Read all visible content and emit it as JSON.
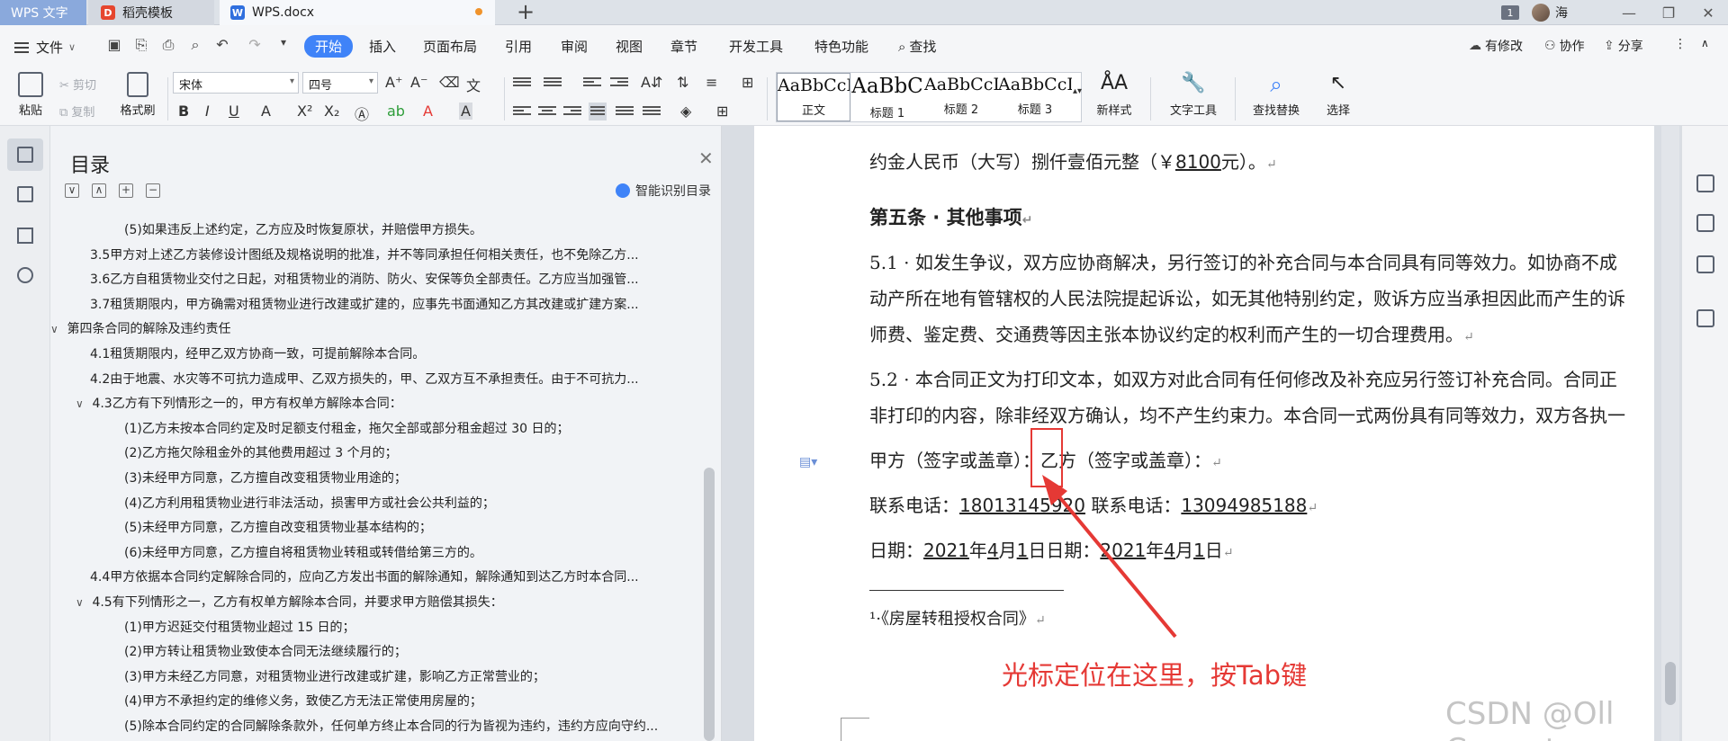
{
  "titlebar": {
    "tabs": [
      {
        "label": "WPS 文字"
      },
      {
        "label": "稻壳模板"
      },
      {
        "label": "WPS.docx"
      }
    ],
    "new_tab": "+",
    "window_count": "1",
    "username": "海",
    "win_min": "—",
    "win_max": "❐",
    "win_close": "✕"
  },
  "menubar": {
    "file": "文件",
    "tabs": [
      "开始",
      "插入",
      "页面布局",
      "引用",
      "审阅",
      "视图",
      "章节",
      "开发工具",
      "特色功能",
      "查找"
    ],
    "active_tab": "开始",
    "right": {
      "changes": "有修改",
      "collab": "协作",
      "share": "分享"
    }
  },
  "ribbon": {
    "paste": "粘贴",
    "cut": "剪切",
    "copy": "复制",
    "format_painter": "格式刷",
    "font_name": "宋体",
    "font_size": "四号",
    "styles": [
      {
        "sample": "AaBbCcDd",
        "name": "正文"
      },
      {
        "sample": "AaBbC",
        "name": "标题 1"
      },
      {
        "sample": "AaBbCcD",
        "name": "标题 2"
      },
      {
        "sample": "AaBbCcD",
        "name": "标题 3"
      }
    ],
    "new_style": "新样式",
    "text_tools": "文字工具",
    "find_replace": "查找替换",
    "select": "选择"
  },
  "toc": {
    "title": "目录",
    "smart": "智能识别目录",
    "items": [
      {
        "text": "(5)如果违反上述约定，乙方应及时恢复原状，并赔偿甲方损失。",
        "level": 3,
        "arrow": ""
      },
      {
        "text": "3.5甲方对上述乙方装修设计图纸及规格说明的批准，并不等同承担任何相关责任，也不免除乙方...",
        "level": 2,
        "arrow": ""
      },
      {
        "text": "3.6乙方自租赁物业交付之日起，对租赁物业的消防、防火、安保等负全部责任。乙方应当加强管...",
        "level": 2,
        "arrow": ""
      },
      {
        "text": "3.7租赁期限内，甲方确需对租赁物业进行改建或扩建的，应事先书面通知乙方其改建或扩建方案...",
        "level": 2,
        "arrow": ""
      },
      {
        "text": "第四条合同的解除及违约责任",
        "level": 1,
        "arrow": "∨"
      },
      {
        "text": "4.1租赁期限内，经甲乙双方协商一致，可提前解除本合同。",
        "level": 2,
        "arrow": ""
      },
      {
        "text": "4.2由于地震、水灾等不可抗力造成甲、乙双方损失的，甲、乙双方互不承担责任。由于不可抗力...",
        "level": 2,
        "arrow": ""
      },
      {
        "text": "4.3乙方有下列情形之一的，甲方有权单方解除本合同：",
        "level": 2,
        "arrow": "∨"
      },
      {
        "text": "(1)乙方未按本合同约定及时足额支付租金，拖欠全部或部分租金超过 30 日的；",
        "level": 3,
        "arrow": ""
      },
      {
        "text": "(2)乙方拖欠除租金外的其他费用超过 3 个月的；",
        "level": 3,
        "arrow": ""
      },
      {
        "text": "(3)未经甲方同意，乙方擅自改变租赁物业用途的；",
        "level": 3,
        "arrow": ""
      },
      {
        "text": "(4)乙方利用租赁物业进行非法活动，损害甲方或社会公共利益的；",
        "level": 3,
        "arrow": ""
      },
      {
        "text": "(5)未经甲方同意，乙方擅自改变租赁物业基本结构的；",
        "level": 3,
        "arrow": ""
      },
      {
        "text": "(6)未经甲方同意，乙方擅自将租赁物业转租或转借给第三方的。",
        "level": 3,
        "arrow": ""
      },
      {
        "text": "4.4甲方依据本合同约定解除合同的，应向乙方发出书面的解除通知，解除通知到达乙方时本合同...",
        "level": 2,
        "arrow": ""
      },
      {
        "text": "4.5有下列情形之一，乙方有权单方解除本合同，并要求甲方赔偿其损失：",
        "level": 2,
        "arrow": "∨"
      },
      {
        "text": "(1)甲方迟延交付租赁物业超过 15 日的；",
        "level": 3,
        "arrow": ""
      },
      {
        "text": "(2)甲方转让租赁物业致使本合同无法继续履行的；",
        "level": 3,
        "arrow": ""
      },
      {
        "text": "(3)甲方未经乙方同意，对租赁物业进行改建或扩建，影响乙方正常营业的；",
        "level": 3,
        "arrow": ""
      },
      {
        "text": "(4)甲方不承担约定的维修义务，致使乙方无法正常使用房屋的；",
        "level": 3,
        "arrow": ""
      },
      {
        "text": "(5)除本合同约定的合同解除条款外，任何单方终止本合同的行为皆视为违约，违约方应向守约...",
        "level": 3,
        "arrow": ""
      }
    ]
  },
  "document": {
    "line_deposit_a": "约金人民币（大写）捌仟壹佰元整（￥",
    "line_deposit_amount": "8100",
    "line_deposit_b": "元）。",
    "heading": "第五条 · 其他事项",
    "p51_l1": "5.1 · 如发生争议，双方应协商解决，另行签订的补充合同与本合同具有同等效力。如协商不成",
    "p51_l2": "动产所在地有管辖权的人民法院提起诉讼，如无其他特别约定，败诉方应当承担因此而产生的诉",
    "p51_l3": "师费、鉴定费、交通费等因主张本协议约定的权利而产生的一切合理费用。",
    "p52_l1": "5.2 · 本合同正文为打印文本，如双方对此合同有任何修改及补充应另行签订补充合同。合同正",
    "p52_l2": "非打印的内容，除非经双方确认，均不产生约束力。本合同一式两份具有同等效力，双方各执一",
    "sign_line": "甲方（签字或盖章）：乙方（签字或盖章）：",
    "phone_label_a": "联系电话：",
    "phone_a": "18013145920",
    "phone_label_b": "联系电话：",
    "phone_b": "13094985188",
    "date_label_a": "日期：",
    "year_a": "2021",
    "year_unit": "年",
    "month_a": "4",
    "month_unit": "月",
    "day_a": "1",
    "day_unit": "日",
    "date_label_b": "日期：",
    "footnote_marker": "¹·",
    "footnote": "《房屋转租授权合同》",
    "para_mark": "↵"
  },
  "annotation": {
    "text": "光标定位在这里，按Tab键",
    "color": "#e53935"
  },
  "watermark": "CSDN @Oll Correct",
  "colors": {
    "accent": "#3f83f8",
    "annotation": "#e53935",
    "tab_wps": "#8aa9dc"
  }
}
